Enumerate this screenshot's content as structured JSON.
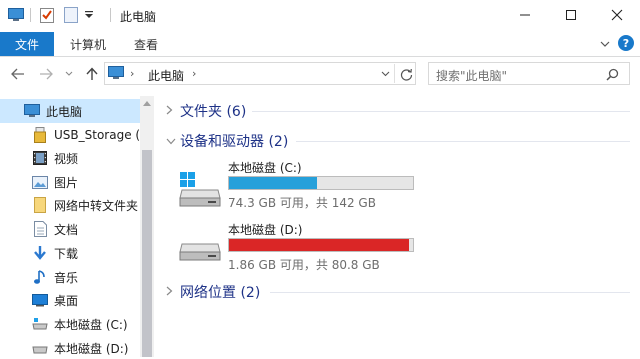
{
  "window": {
    "title": "此电脑"
  },
  "ribbon": {
    "tabs": [
      "文件",
      "计算机",
      "查看"
    ]
  },
  "address": {
    "path": "此电脑",
    "separator": "›"
  },
  "search": {
    "placeholder": "搜索\"此电脑\""
  },
  "nav_pane": {
    "items": [
      {
        "label": "此电脑",
        "icon": "pc-icon"
      },
      {
        "label": "USB_Storage (F",
        "icon": "usb-drive-icon"
      },
      {
        "label": "视频",
        "icon": "video-folder-icon"
      },
      {
        "label": "图片",
        "icon": "pictures-folder-icon"
      },
      {
        "label": "网络中转文件夹",
        "icon": "folder-icon"
      },
      {
        "label": "文档",
        "icon": "documents-folder-icon"
      },
      {
        "label": "下载",
        "icon": "downloads-icon"
      },
      {
        "label": "音乐",
        "icon": "music-icon"
      },
      {
        "label": "桌面",
        "icon": "desktop-icon"
      },
      {
        "label": "本地磁盘 (C:)",
        "icon": "drive-icon"
      },
      {
        "label": "本地磁盘 (D:)",
        "icon": "drive-icon"
      }
    ]
  },
  "content": {
    "groups": [
      {
        "label": "文件夹 (6)",
        "expanded": false
      },
      {
        "label": "设备和驱动器 (2)",
        "expanded": true
      },
      {
        "label": "网络位置 (2)",
        "expanded": false
      }
    ],
    "drives": [
      {
        "name": "本地磁盘 (C:)",
        "info": "74.3 GB 可用，共 142 GB",
        "used_fraction": 0.48,
        "bar_color": "#26a0da"
      },
      {
        "name": "本地磁盘 (D:)",
        "info": "1.86 GB 可用，共 80.8 GB",
        "used_fraction": 0.977,
        "bar_color": "#da2626"
      }
    ]
  },
  "colors": {
    "accent": "#1979ca",
    "group_header": "#1e3287"
  }
}
